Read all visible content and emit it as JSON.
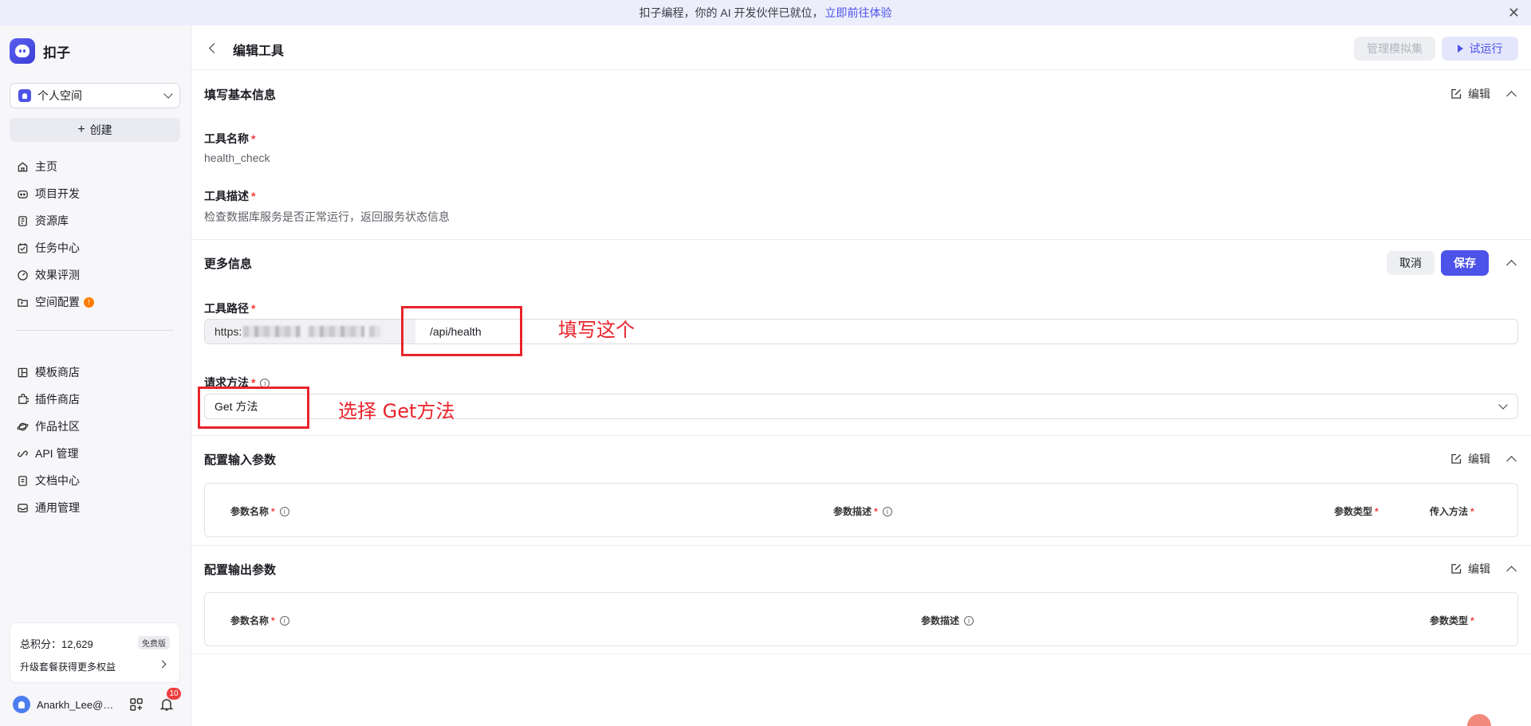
{
  "banner": {
    "text": "扣子编程，你的 AI 开发伙伴已就位，",
    "link": "立即前往体验",
    "close": "✕"
  },
  "sidebar": {
    "logo_text": "扣子",
    "space_select": "个人空间",
    "create_label": "创建",
    "nav_primary": [
      {
        "label": "主页",
        "icon": "home-icon"
      },
      {
        "label": "项目开发",
        "icon": "robot-icon"
      },
      {
        "label": "资源库",
        "icon": "library-icon"
      },
      {
        "label": "任务中心",
        "icon": "task-icon"
      },
      {
        "label": "效果评测",
        "icon": "gauge-icon"
      },
      {
        "label": "空间配置",
        "icon": "folder-settings-icon",
        "badge": "!"
      }
    ],
    "nav_secondary": [
      {
        "label": "模板商店",
        "icon": "template-icon"
      },
      {
        "label": "插件商店",
        "icon": "plugin-icon"
      },
      {
        "label": "作品社区",
        "icon": "planet-icon"
      },
      {
        "label": "API 管理",
        "icon": "link-icon"
      },
      {
        "label": "文档中心",
        "icon": "doc-icon"
      },
      {
        "label": "通用管理",
        "icon": "inbox-icon"
      }
    ],
    "points": {
      "label": "总积分：12,629",
      "plan": "免费版",
      "upgrade": "升级套餐获得更多权益"
    },
    "user": {
      "name": "Anarkh_Lee@…",
      "notifications": "10"
    }
  },
  "header": {
    "title": "编辑工具",
    "manage_mock": "管理模拟集",
    "trial_run": "试运行"
  },
  "basic_info": {
    "title": "填写基本信息",
    "edit": "编辑",
    "name_label": "工具名称",
    "name_value": "health_check",
    "desc_label": "工具描述",
    "desc_value": "检查数据库服务是否正常运行，返回服务状态信息"
  },
  "more_info": {
    "title": "更多信息",
    "cancel": "取消",
    "save": "保存",
    "path_label": "工具路径",
    "path_prefix": "https:",
    "path_value": "/api/health",
    "method_label": "请求方法",
    "method_value": "Get 方法"
  },
  "input_params": {
    "title": "配置输入参数",
    "edit": "编辑",
    "columns": [
      "参数名称",
      "参数描述",
      "参数类型",
      "传入方法"
    ]
  },
  "output_params": {
    "title": "配置输出参数",
    "edit": "编辑",
    "columns": [
      "参数名称",
      "参数描述",
      "参数类型"
    ]
  },
  "annotations": {
    "fill_this": "填写这个",
    "select_get": "选择 Get方法"
  },
  "colors": {
    "accent": "#4d53e8",
    "annotation": "#e8242c",
    "required": "#f03d3d"
  }
}
